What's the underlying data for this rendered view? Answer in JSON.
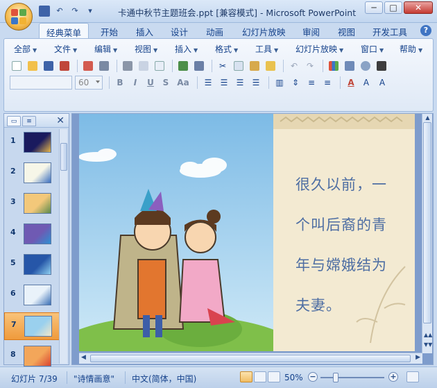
{
  "window": {
    "title": "卡通中秋节主题班会.ppt [兼容模式] - Microsoft PowerPoint",
    "controls": {
      "minimize": "─",
      "maximize": "□",
      "close": "✕"
    }
  },
  "qat": {
    "items": [
      "save-icon",
      "undo-icon",
      "redo-icon",
      "customize-icon"
    ]
  },
  "ribbon_tabs": [
    {
      "label": "经典菜单",
      "active": true
    },
    {
      "label": "开始"
    },
    {
      "label": "插入"
    },
    {
      "label": "设计"
    },
    {
      "label": "动画"
    },
    {
      "label": "幻灯片放映"
    },
    {
      "label": "审阅"
    },
    {
      "label": "视图"
    },
    {
      "label": "开发工具"
    }
  ],
  "help": "?",
  "menus": [
    "全部",
    "文件",
    "编辑",
    "视图",
    "插入",
    "格式",
    "工具",
    "幻灯片放映",
    "窗口",
    "帮助"
  ],
  "font": {
    "name": "",
    "size": "60"
  },
  "format_buttons": {
    "bold": "B",
    "italic": "I",
    "underline": "U",
    "shadow": "S",
    "case": "Aa",
    "font_color": "A"
  },
  "slides_panel": {
    "close": "✕",
    "slides": [
      {
        "num": "1",
        "colors": [
          "#1a1a5e",
          "#e8b84a"
        ]
      },
      {
        "num": "2",
        "colors": [
          "#f6f6e8",
          "#3b6fbf"
        ]
      },
      {
        "num": "3",
        "colors": [
          "#f3c87a",
          "#5b8a4c"
        ]
      },
      {
        "num": "4",
        "colors": [
          "#6f5ab3",
          "#2e8fd1"
        ]
      },
      {
        "num": "5",
        "colors": [
          "#2656a8",
          "#8fd0f0"
        ]
      },
      {
        "num": "6",
        "colors": [
          "#e9f2fa",
          "#3a6fb5"
        ]
      },
      {
        "num": "7",
        "colors": [
          "#9ad0ee",
          "#f4e8c8"
        ],
        "selected": true
      },
      {
        "num": "8",
        "colors": [
          "#f3a65a",
          "#d9432f"
        ]
      }
    ]
  },
  "slide": {
    "text_lines": [
      "很久以前，一",
      "个叫后裔的青",
      "年与嫦娥结为",
      "夫妻。"
    ]
  },
  "status": {
    "slide_info": "幻灯片 7/39",
    "theme": "\"诗情画意\"",
    "language": "中文(简体，中国)",
    "zoom": "50%",
    "zoom_out": "−",
    "zoom_in": "+"
  },
  "colors": {
    "accent": "#15428b",
    "ribbon_bg": "#dfe9f6",
    "selected_slide": "#ef9a3c",
    "slide_text": "#4e6ea3",
    "sky": "#8cc8ec",
    "paper": "#f3ead2"
  }
}
